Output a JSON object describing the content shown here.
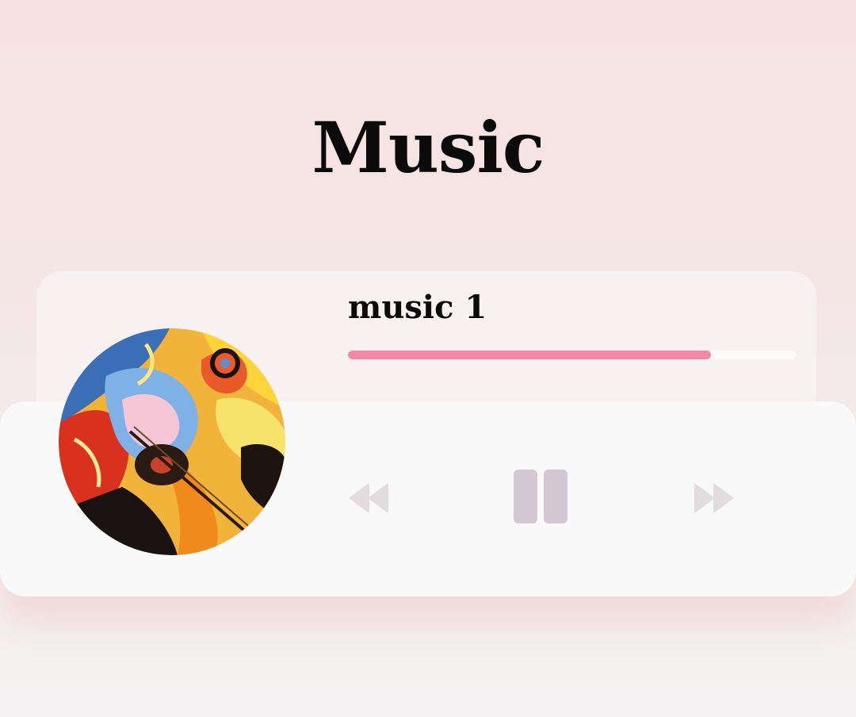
{
  "header": {
    "title": "Music"
  },
  "player": {
    "track_title": "music 1",
    "progress": 0.81,
    "album_art": "abstract-guitar-art",
    "controls": {
      "rewind_icon": "rewind-icon",
      "pause_icon": "pause-icon",
      "forward_icon": "fast-forward-icon"
    }
  },
  "colors": {
    "progress_fill": "#f288a5",
    "progress_track": "#fdfafa",
    "pause_icon": "#d3c8d4",
    "skip_icons": "#e2dcdf",
    "background": "#f6e2e2"
  }
}
